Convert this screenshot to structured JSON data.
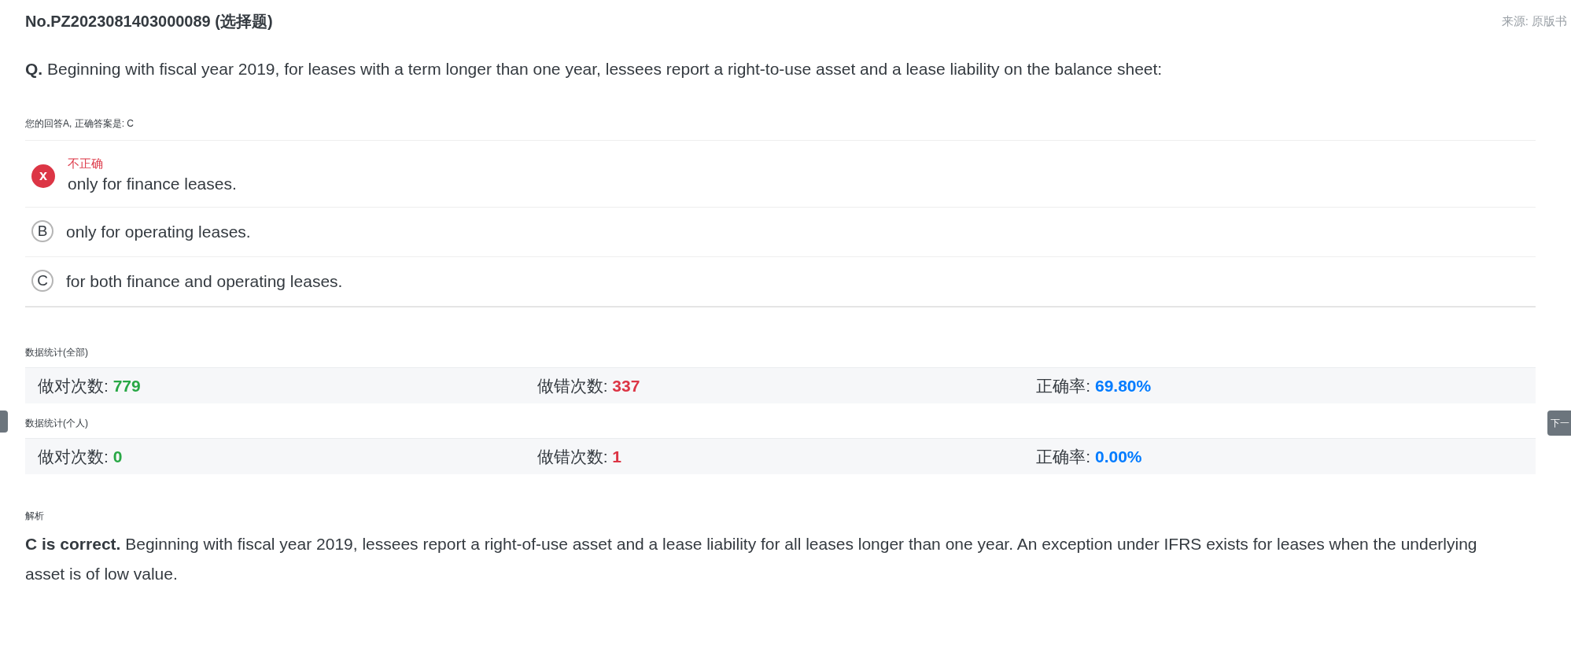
{
  "side_tabs": {
    "right": "下一"
  },
  "header": {
    "title": "No.PZ2023081403000089 (选择题)",
    "source": "来源: 原版书"
  },
  "question": {
    "prefix": "Q.",
    "text": "Beginning with fiscal year 2019, for leases with a term longer than one year, lessees report a right-to-use asset and a lease liability on the balance sheet:"
  },
  "answer_note": "您的回答A, 正确答案是: C",
  "options": [
    {
      "marker": "x",
      "selected": true,
      "feedback": "不正确",
      "text": "only for finance leases."
    },
    {
      "marker": "B",
      "selected": false,
      "text": "only for operating leases."
    },
    {
      "marker": "C",
      "selected": false,
      "text": "for both finance and operating leases."
    }
  ],
  "stats": [
    {
      "title": "数据统计(全部)",
      "items": [
        {
          "label": "做对次数:",
          "value": "779",
          "color": "#28a745"
        },
        {
          "label": "做错次数:",
          "value": "337",
          "color": "#dc3545"
        },
        {
          "label": "正确率:",
          "value": "69.80%",
          "color": "#007bff"
        }
      ]
    },
    {
      "title": "数据统计(个人)",
      "items": [
        {
          "label": "做对次数:",
          "value": "0",
          "color": "#28a745"
        },
        {
          "label": "做错次数:",
          "value": "1",
          "color": "#dc3545"
        },
        {
          "label": "正确率:",
          "value": "0.00%",
          "color": "#007bff"
        }
      ]
    }
  ],
  "analysis": {
    "title": "解析",
    "text": "**C is correct.** Beginning with fiscal year 2019, lessees report a right-of-use asset and a lease liability for all leases longer than one year. An exception under IFRS exists for leases when the underlying asset is of low value."
  }
}
